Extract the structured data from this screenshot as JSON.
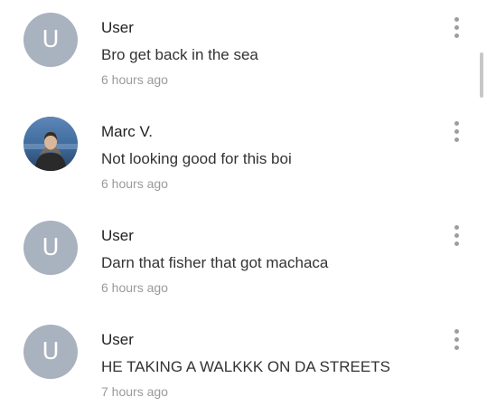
{
  "comments": [
    {
      "author": "User",
      "avatar_letter": "U",
      "avatar_type": "letter",
      "text": "Bro get back in the sea",
      "time": "6 hours ago"
    },
    {
      "author": "Marc V.",
      "avatar_letter": "",
      "avatar_type": "photo",
      "text": "Not looking good for this boi",
      "time": "6 hours ago"
    },
    {
      "author": "User",
      "avatar_letter": "U",
      "avatar_type": "letter",
      "text": "Darn that fisher that got machaca",
      "time": "6 hours ago"
    },
    {
      "author": "User",
      "avatar_letter": "U",
      "avatar_type": "letter",
      "text": "HE TAKING A WALKKK ON DA STREETS",
      "time": "7 hours ago"
    }
  ],
  "icons": {
    "more": "more-vertical-icon",
    "avatar_default": "user-letter-avatar"
  },
  "colors": {
    "avatar_bg": "#a9b2bf",
    "name": "#222222",
    "text": "#333333",
    "time": "#9a9a9a",
    "more_dots": "#9e9e9e"
  }
}
